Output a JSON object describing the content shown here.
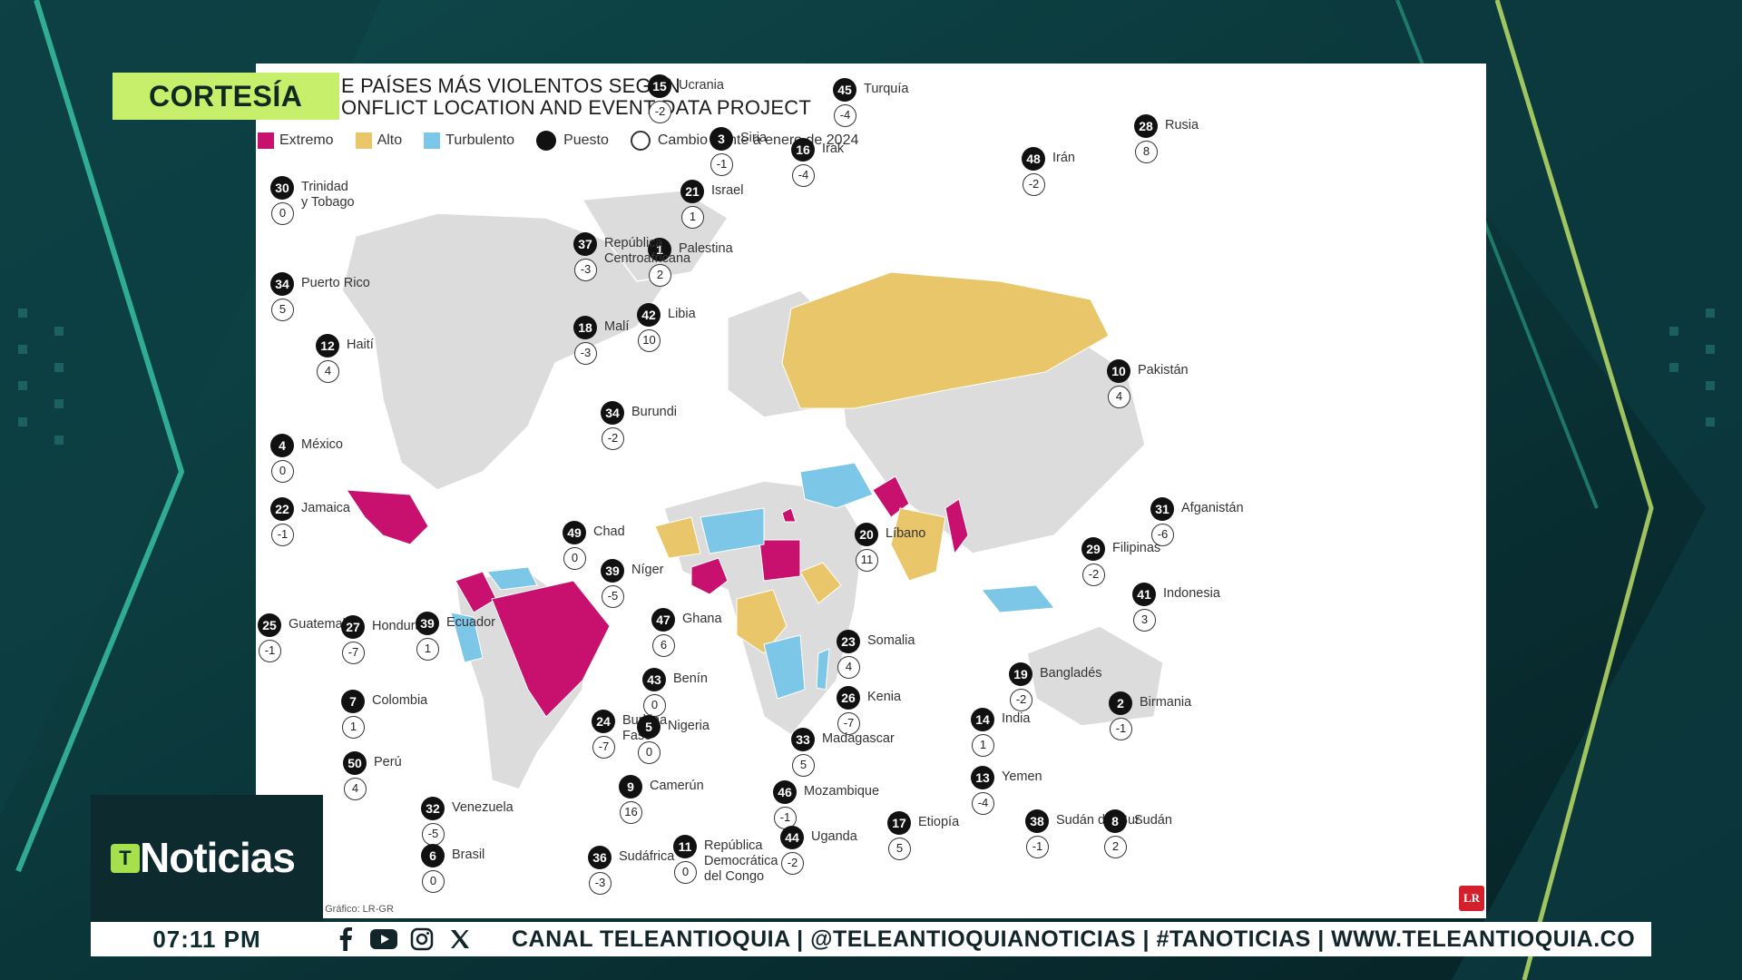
{
  "courtesy_label": "CORTESÍA",
  "map": {
    "title_line_1": "E PAÍSES MÁS VIOLENTOS SEGÚN",
    "title_line_2": "ONFLICT LOCATION AND EVENT DATA PROJECT",
    "legend": [
      {
        "label": "Extremo",
        "kind": "swatch",
        "color": "#c8106e"
      },
      {
        "label": "Alto",
        "kind": "swatch",
        "color": "#e9c66a"
      },
      {
        "label": "Turbulento",
        "kind": "swatch",
        "color": "#7cc6e8"
      },
      {
        "label": "Puesto",
        "kind": "dot",
        "color": "#111111"
      },
      {
        "label": "Cambio frente a enero de 2024",
        "kind": "ring",
        "color": "#333333"
      }
    ],
    "countries": [
      {
        "name": "Trinidad\ny Tobago",
        "rank": "30",
        "change": "0"
      },
      {
        "name": "Puerto Rico",
        "rank": "34",
        "change": "5"
      },
      {
        "name": "Haití",
        "rank": "12",
        "change": "4"
      },
      {
        "name": "México",
        "rank": "4",
        "change": "0"
      },
      {
        "name": "Jamaica",
        "rank": "22",
        "change": "-1"
      },
      {
        "name": "Guatemala",
        "rank": "25",
        "change": "-1"
      },
      {
        "name": "Honduras",
        "rank": "27",
        "change": "-7"
      },
      {
        "name": "Ecuador",
        "rank": "39",
        "change": "1"
      },
      {
        "name": "Colombia",
        "rank": "7",
        "change": "1"
      },
      {
        "name": "Perú",
        "rank": "50",
        "change": "4"
      },
      {
        "name": "Venezuela",
        "rank": "32",
        "change": "-5"
      },
      {
        "name": "Brasil",
        "rank": "6",
        "change": "0"
      },
      {
        "name": "Ucrania",
        "rank": "15",
        "change": "-2"
      },
      {
        "name": "Siria",
        "rank": "3",
        "change": "-1"
      },
      {
        "name": "Israel",
        "rank": "21",
        "change": "1"
      },
      {
        "name": "Palestina",
        "rank": "1",
        "change": "2"
      },
      {
        "name": "República\nCentroafricana",
        "rank": "37",
        "change": "-3"
      },
      {
        "name": "Malí",
        "rank": "18",
        "change": "-3"
      },
      {
        "name": "Libia",
        "rank": "42",
        "change": "10"
      },
      {
        "name": "Burundi",
        "rank": "34",
        "change": "-2"
      },
      {
        "name": "Chad",
        "rank": "49",
        "change": "0"
      },
      {
        "name": "Níger",
        "rank": "39",
        "change": "-5"
      },
      {
        "name": "Ghana",
        "rank": "47",
        "change": "6"
      },
      {
        "name": "Benín",
        "rank": "43",
        "change": "0"
      },
      {
        "name": "Burkina\nFaso",
        "rank": "24",
        "change": "-7"
      },
      {
        "name": "Nigeria",
        "rank": "5",
        "change": "0"
      },
      {
        "name": "Camerún",
        "rank": "9",
        "change": "16"
      },
      {
        "name": "Sudáfrica",
        "rank": "36",
        "change": "-3"
      },
      {
        "name": "República\nDemocrática\ndel Congo",
        "rank": "11",
        "change": "0"
      },
      {
        "name": "Turquía",
        "rank": "45",
        "change": "-4"
      },
      {
        "name": "Irak",
        "rank": "16",
        "change": "-4"
      },
      {
        "name": "Irán",
        "rank": "48",
        "change": "-2"
      },
      {
        "name": "Rusia",
        "rank": "28",
        "change": "8"
      },
      {
        "name": "Pakistán",
        "rank": "10",
        "change": "4"
      },
      {
        "name": "Líbano",
        "rank": "20",
        "change": "11"
      },
      {
        "name": "Afganistán",
        "rank": "31",
        "change": "-6"
      },
      {
        "name": "Filipinas",
        "rank": "29",
        "change": "-2"
      },
      {
        "name": "Indonesia",
        "rank": "41",
        "change": "3"
      },
      {
        "name": "Somalia",
        "rank": "23",
        "change": "4"
      },
      {
        "name": "Kenia",
        "rank": "26",
        "change": "-7"
      },
      {
        "name": "Madagascar",
        "rank": "33",
        "change": "5"
      },
      {
        "name": "Mozambique",
        "rank": "46",
        "change": "-1"
      },
      {
        "name": "Uganda",
        "rank": "44",
        "change": "-2"
      },
      {
        "name": "Etiopía",
        "rank": "17",
        "change": "5"
      },
      {
        "name": "Bangladés",
        "rank": "19",
        "change": "-2"
      },
      {
        "name": "India",
        "rank": "14",
        "change": "1"
      },
      {
        "name": "Birmania",
        "rank": "2",
        "change": "-1"
      },
      {
        "name": "Yemen",
        "rank": "13",
        "change": "-4"
      },
      {
        "name": "Sudán del Sur",
        "rank": "38",
        "change": "-1"
      },
      {
        "name": "Sudán",
        "rank": "8",
        "change": "2"
      }
    ],
    "credit": "/ Gráfico: LR-GR",
    "logo": "LR"
  },
  "broadcast": {
    "logo_mark": "T",
    "logo_text": "Noticias",
    "time": "07:11 PM",
    "social_icons": [
      "facebook-icon",
      "youtube-icon",
      "instagram-icon",
      "x-icon"
    ],
    "ticker": "CANAL TELEANTIOQUIA  |  @TELEANTIOQUIANOTICIAS  |  #TANOTICIAS  |  WWW.TELEANTIOQUIA.CO"
  }
}
